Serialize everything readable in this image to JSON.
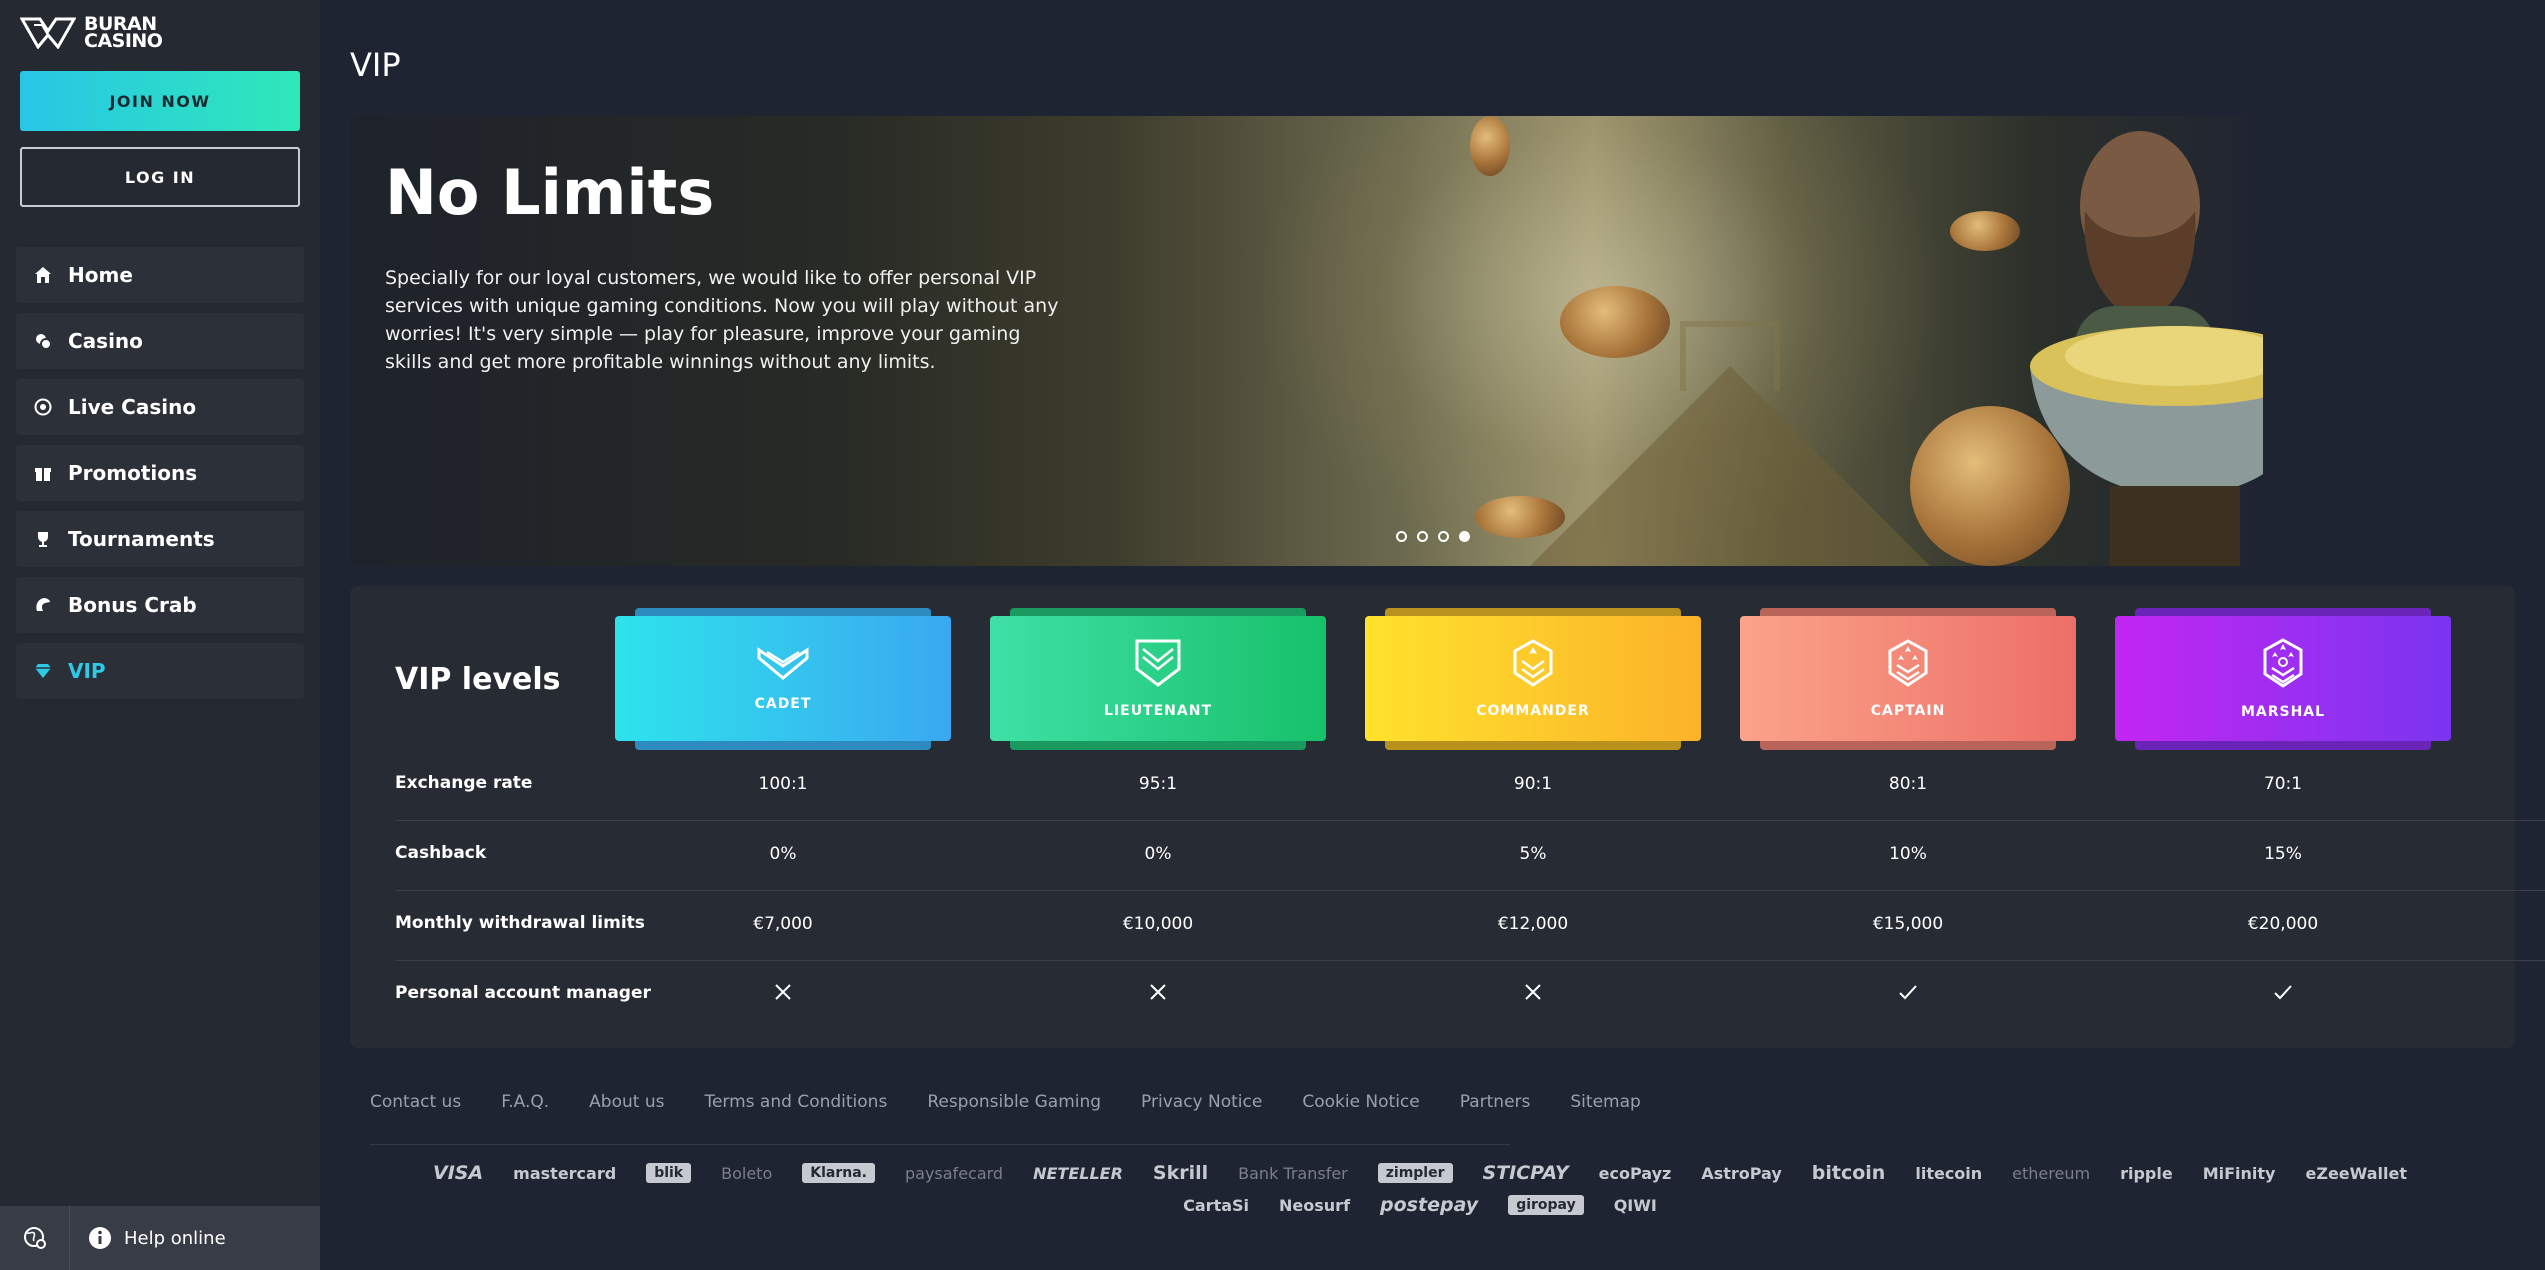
{
  "brand": {
    "line1": "BURAN",
    "line2": "CASINO"
  },
  "auth": {
    "join_label": "JOIN NOW",
    "login_label": "LOG IN"
  },
  "nav": [
    {
      "label": "Home",
      "icon": "home-icon"
    },
    {
      "label": "Casino",
      "icon": "casino-icon"
    },
    {
      "label": "Live Casino",
      "icon": "live-casino-icon"
    },
    {
      "label": "Promotions",
      "icon": "gift-icon"
    },
    {
      "label": "Tournaments",
      "icon": "trophy-icon"
    },
    {
      "label": "Bonus Crab",
      "icon": "crab-claw-icon"
    },
    {
      "label": "VIP",
      "icon": "diamond-icon",
      "active": true
    }
  ],
  "sidebar_bottom": {
    "help_label": "Help online"
  },
  "page": {
    "title": "VIP"
  },
  "hero": {
    "heading": "No Limits",
    "text": "Specially for our loyal customers, we would like to offer personal VIP services with unique gaming conditions. Now you will play without any worries! It's very simple — play for pleasure, improve your gaming skills and get more profitable winnings without any limits.",
    "slides_total": 4,
    "active_slide": 4
  },
  "vip": {
    "title": "VIP levels",
    "levels": [
      {
        "name": "CADET",
        "color_from": "#2ee3ec",
        "color_to": "#3aa8f0",
        "back": "#2e8bbf"
      },
      {
        "name": "LIEUTENANT",
        "color_from": "#3fe0a6",
        "color_to": "#17c16a",
        "back": "#1a9a5e"
      },
      {
        "name": "COMMANDER",
        "color_from": "#ffe22c",
        "color_to": "#fbb32a",
        "back": "#b8921c"
      },
      {
        "name": "CAPTAIN",
        "color_from": "#fba38a",
        "color_to": "#ed6f67",
        "back": "#b86459"
      },
      {
        "name": "MARSHAL",
        "color_from": "#c326f2",
        "color_to": "#7a35f0",
        "back": "#6a25b8"
      }
    ],
    "rows": [
      {
        "label": "Exchange rate",
        "values": [
          "100:1",
          "95:1",
          "90:1",
          "80:1",
          "70:1"
        ]
      },
      {
        "label": "Cashback",
        "values": [
          "0%",
          "0%",
          "5%",
          "10%",
          "15%"
        ]
      },
      {
        "label": "Monthly withdrawal limits",
        "values": [
          "€7,000",
          "€10,000",
          "€12,000",
          "€15,000",
          "€20,000"
        ]
      },
      {
        "label": "Personal account manager",
        "values": [
          false,
          false,
          false,
          true,
          true
        ]
      }
    ]
  },
  "footer": {
    "links": [
      "Contact us",
      "F.A.Q.",
      "About us",
      "Terms and Conditions",
      "Responsible Gaming",
      "Privacy Notice",
      "Cookie Notice",
      "Partners",
      "Sitemap"
    ],
    "payments": [
      "VISA",
      "mastercard",
      "blik",
      "Boleto",
      "Klarna.",
      "paysafecard",
      "NETELLER",
      "Skrill",
      "Bank Transfer",
      "zimpler",
      "STICPAY",
      "ecoPayz",
      "AstroPay",
      "bitcoin",
      "litecoin",
      "ethereum",
      "ripple",
      "MiFinity",
      "eZeeWallet",
      "CartaSi",
      "Neosurf",
      "postepay",
      "giropay",
      "QIWI"
    ]
  }
}
